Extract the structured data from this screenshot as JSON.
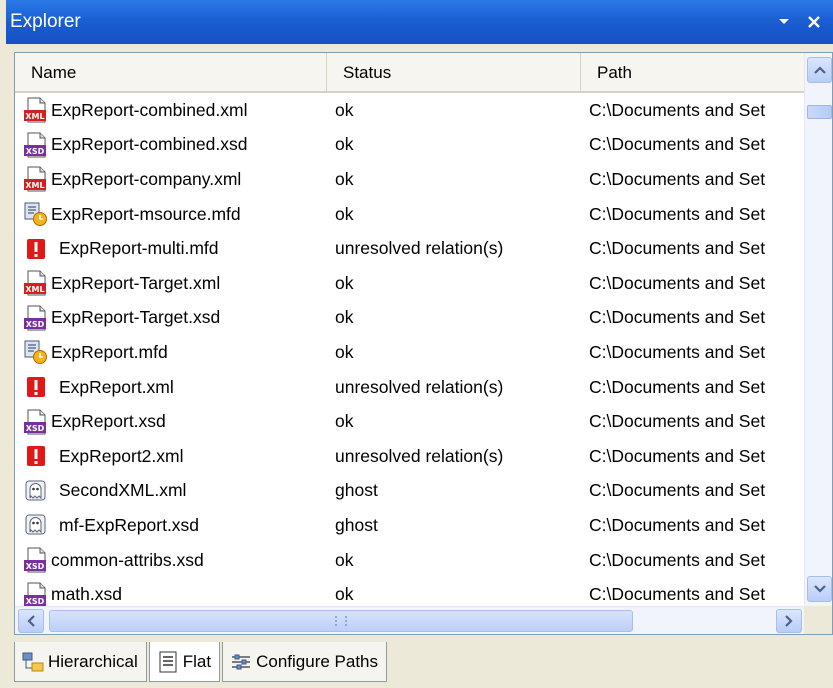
{
  "window": {
    "title": "Explorer"
  },
  "columns": {
    "name": "Name",
    "status": "Status",
    "path": "Path"
  },
  "rows": [
    {
      "icon": "xml-file-icon",
      "name": "ExpReport-combined.xml",
      "status": "ok",
      "path": "C:\\Documents and Set"
    },
    {
      "icon": "xsd-file-icon",
      "name": "ExpReport-combined.xsd",
      "status": "ok",
      "path": "C:\\Documents and Set"
    },
    {
      "icon": "xml-file-icon",
      "name": "ExpReport-company.xml",
      "status": "ok",
      "path": "C:\\Documents and Set"
    },
    {
      "icon": "mfd-file-icon",
      "name": "ExpReport-msource.mfd",
      "status": "ok",
      "path": "C:\\Documents and Set"
    },
    {
      "icon": "error-icon",
      "name": "ExpReport-multi.mfd",
      "status": "unresolved relation(s)",
      "path": "C:\\Documents and Set"
    },
    {
      "icon": "xml-file-icon",
      "name": "ExpReport-Target.xml",
      "status": "ok",
      "path": "C:\\Documents and Set"
    },
    {
      "icon": "xsd-file-icon",
      "name": "ExpReport-Target.xsd",
      "status": "ok",
      "path": "C:\\Documents and Set"
    },
    {
      "icon": "mfd-file-icon",
      "name": "ExpReport.mfd",
      "status": "ok",
      "path": "C:\\Documents and Set"
    },
    {
      "icon": "error-icon",
      "name": "ExpReport.xml",
      "status": "unresolved relation(s)",
      "path": "C:\\Documents and Set"
    },
    {
      "icon": "xsd-file-icon",
      "name": "ExpReport.xsd",
      "status": "ok",
      "path": "C:\\Documents and Set"
    },
    {
      "icon": "error-icon",
      "name": "ExpReport2.xml",
      "status": "unresolved relation(s)",
      "path": "C:\\Documents and Set"
    },
    {
      "icon": "ghost-icon",
      "name": "SecondXML.xml",
      "status": "ghost",
      "path": "C:\\Documents and Set"
    },
    {
      "icon": "ghost-icon",
      "name": "mf-ExpReport.xsd",
      "status": "ghost",
      "path": "C:\\Documents and Set"
    },
    {
      "icon": "xsd-file-icon",
      "name": "common-attribs.xsd",
      "status": "ok",
      "path": "C:\\Documents and Set"
    },
    {
      "icon": "xsd-file-icon",
      "name": "math.xsd",
      "status": "ok",
      "path": "C:\\Documents and Set"
    }
  ],
  "tabs": [
    {
      "icon": "hierarchical-icon",
      "label": "Hierarchical",
      "active": false
    },
    {
      "icon": "flat-list-icon",
      "label": "Flat",
      "active": true
    },
    {
      "icon": "configure-paths-icon",
      "label": "Configure Paths",
      "active": false
    }
  ],
  "colors": {
    "titlebar": "#1a5fd3",
    "error": "#e01818",
    "xml_badge": "#d21f1f",
    "xsd_badge": "#7a2fa0"
  }
}
